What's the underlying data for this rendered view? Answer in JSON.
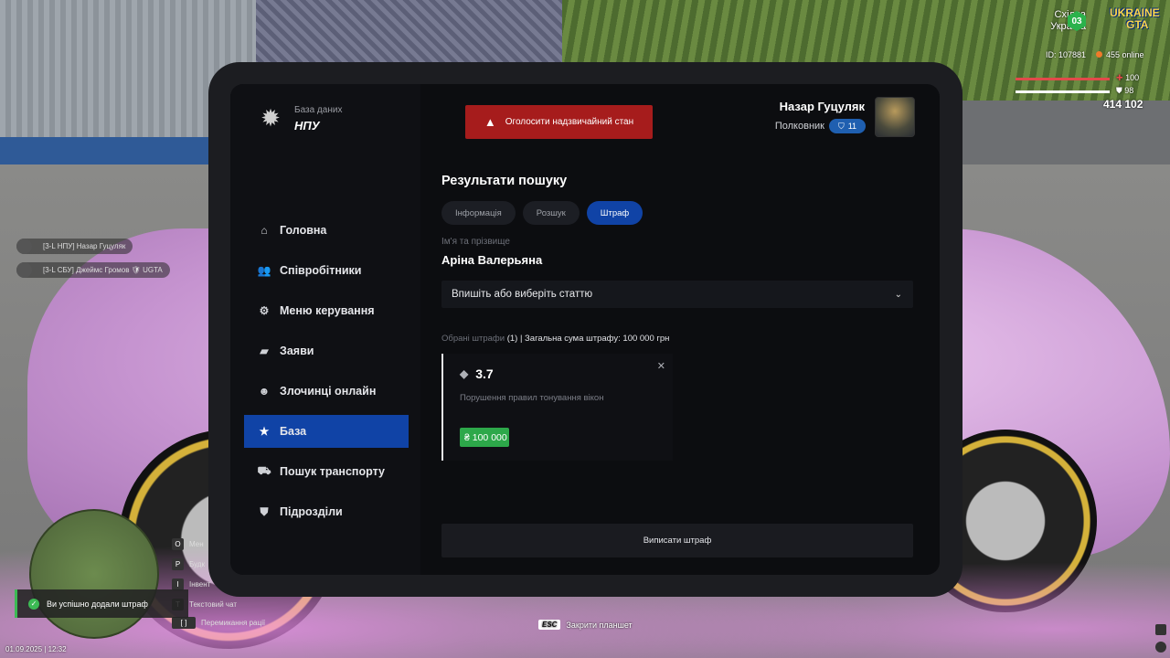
{
  "hud": {
    "region": "Східна\nУкраїна",
    "region_line1": "Східна",
    "region_line2": "Україна",
    "server_badge": "03",
    "logo_line1": "UKRAINE",
    "logo_line2": "GTA",
    "player_id": "ID: 107881",
    "online": "455 online",
    "health": "100",
    "armor": "98",
    "money": "414 102",
    "colors": {
      "health": "#e24a4a",
      "armor": "#ffffff",
      "server": "#2bb24c"
    }
  },
  "chat_tags": [
    {
      "text": "[3-L НПУ] Назар Гуцуляк"
    },
    {
      "text": "[3-L СБУ] Джеймс Громов 🛡 UGTA"
    }
  ],
  "hints": [
    {
      "key": "O",
      "label": "Мен"
    },
    {
      "key": "P",
      "label": "Будк"
    },
    {
      "key": "I",
      "label": "Інвент"
    },
    {
      "key": "T",
      "label": "Текстовий чат"
    },
    {
      "key": "[ ]",
      "label": "Перемикання рації"
    }
  ],
  "toast": {
    "text": "Ви успішно додали штраф",
    "color": "#3cba54"
  },
  "datetime": "01.09.2025 | 12:32",
  "esc_hint": {
    "key": "ESC",
    "label": "Закрити планшет"
  },
  "tablet": {
    "logo_sub": "База даних",
    "logo_main": "НПУ",
    "alert_button": "Оголосити надзвичайний стан",
    "user": {
      "name": "Назар Гуцуляк",
      "rank": "Полковник",
      "rank_level": "11"
    },
    "nav": [
      {
        "label": "Головна",
        "icon": "home-icon",
        "active": false
      },
      {
        "label": "Співробітники",
        "icon": "users-icon",
        "active": false
      },
      {
        "label": "Меню керування",
        "icon": "gear-icon",
        "active": false
      },
      {
        "label": "Заяви",
        "icon": "folder-icon",
        "active": false
      },
      {
        "label": "Злочинці онлайн",
        "icon": "mask-icon",
        "active": false
      },
      {
        "label": "База",
        "icon": "star-icon",
        "active": true
      },
      {
        "label": "Пошук транспорту",
        "icon": "car-icon",
        "active": false
      },
      {
        "label": "Підрозділи",
        "icon": "shield-icon",
        "active": false
      }
    ],
    "content": {
      "title": "Результати пошуку",
      "tabs": [
        {
          "label": "Інформація",
          "active": false
        },
        {
          "label": "Розшук",
          "active": false
        },
        {
          "label": "Штраф",
          "active": true
        }
      ],
      "name_label": "Ім'я та прізвище",
      "person_name": "Аріна Валерьяна",
      "select_placeholder": "Впишіть або виберіть статтю",
      "summary_muted": "Обрані штрафи",
      "summary_rest": " (1) | Загальна сума штрафу: 100 000 грн",
      "fine": {
        "code": "3.7",
        "description": "Порушення правил тонування вікон",
        "amount": "₴ 100 000",
        "amount_color": "#2da84a"
      },
      "submit_button": "Виписати штраф"
    },
    "accent_color": "#1043a6",
    "alert_color": "#a61c1c"
  }
}
